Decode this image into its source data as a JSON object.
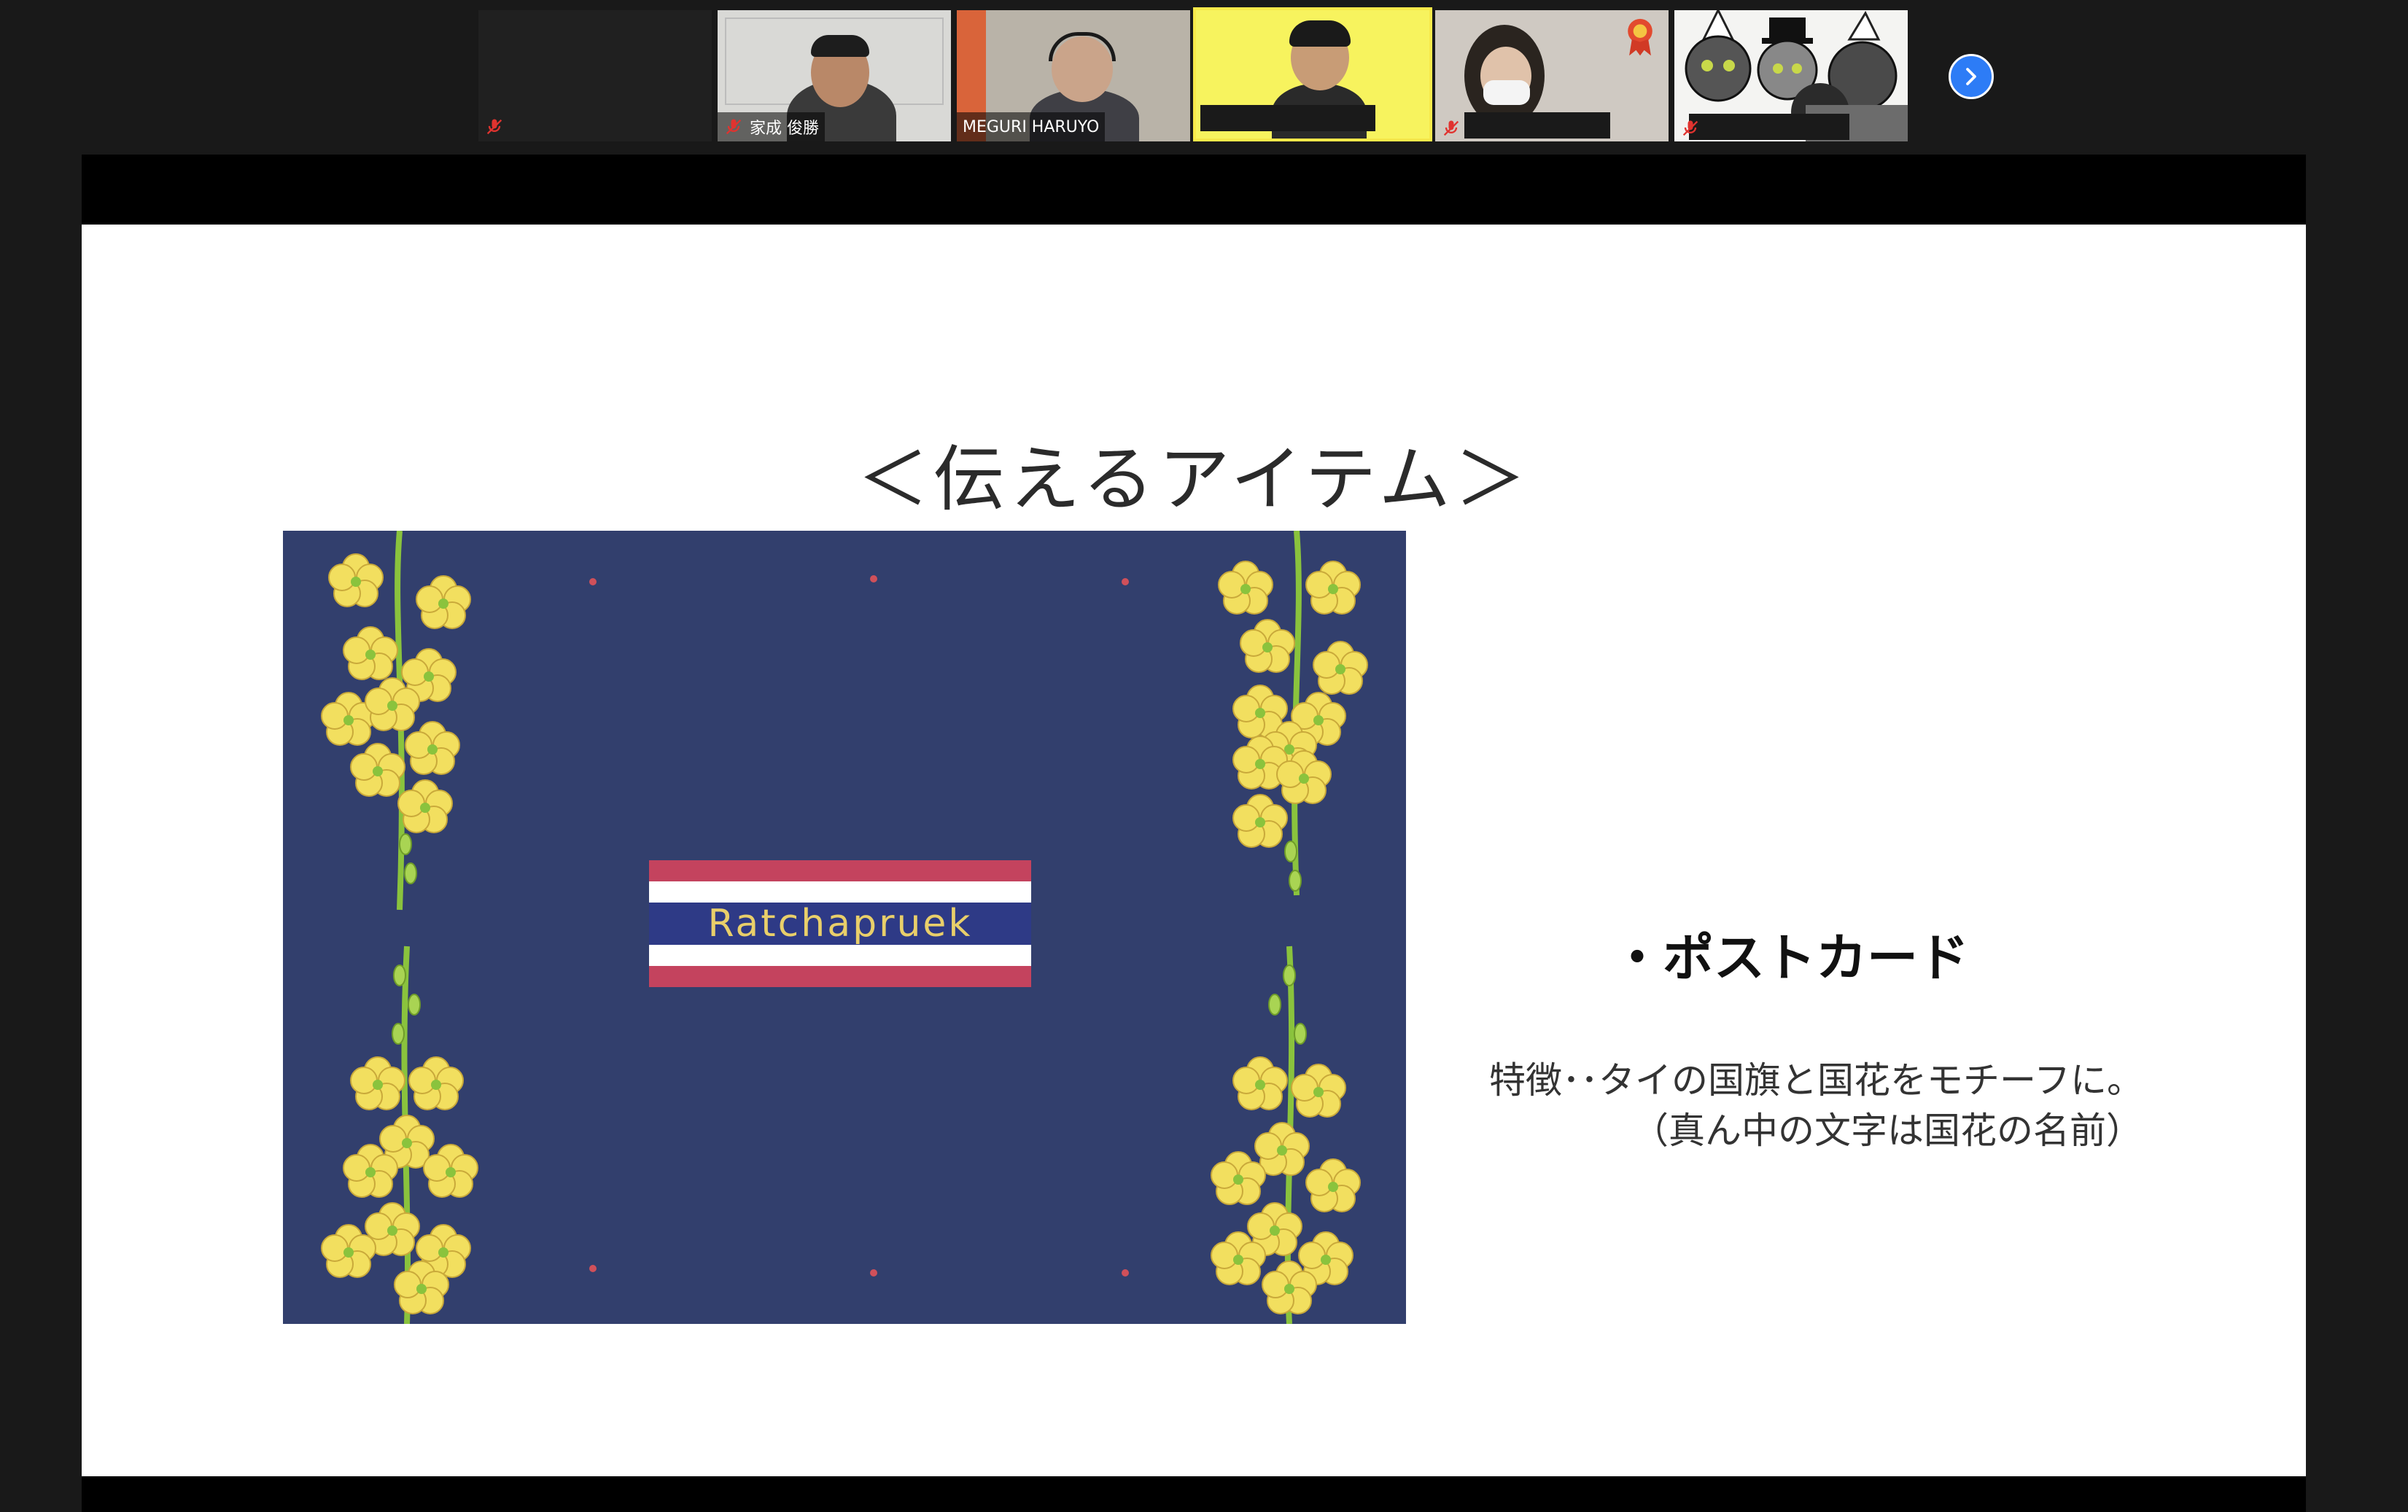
{
  "gallery": {
    "participants": [
      {
        "name": "",
        "muted": true
      },
      {
        "name": "家成 俊勝",
        "muted": true
      },
      {
        "name": "MEGURI HARUYO",
        "muted": false
      },
      {
        "name": "",
        "muted": false,
        "active": true
      },
      {
        "name": "",
        "muted": true
      },
      {
        "name": "",
        "muted": true
      }
    ],
    "next_icon": "chevron-right-icon"
  },
  "slide": {
    "title": "＜伝えるアイテム＞",
    "postcard": {
      "flag_text": "Ratchapruek",
      "flag_colors": {
        "red": "#c4435e",
        "white": "#ffffff",
        "blue": "#2e3a86"
      },
      "background": "#323f6d",
      "flower_color": "#f2df5f",
      "stem_color": "#8ac33d"
    },
    "bullet": "・ポストカード",
    "description": [
      "特徴･･タイの国旗と国花をモチーフに。",
      "（真ん中の文字は国花の名前）"
    ]
  },
  "colors": {
    "active_speaker": "#f7e94a",
    "accent": "#2d7cf6",
    "muted_mic": "#e0332f"
  }
}
